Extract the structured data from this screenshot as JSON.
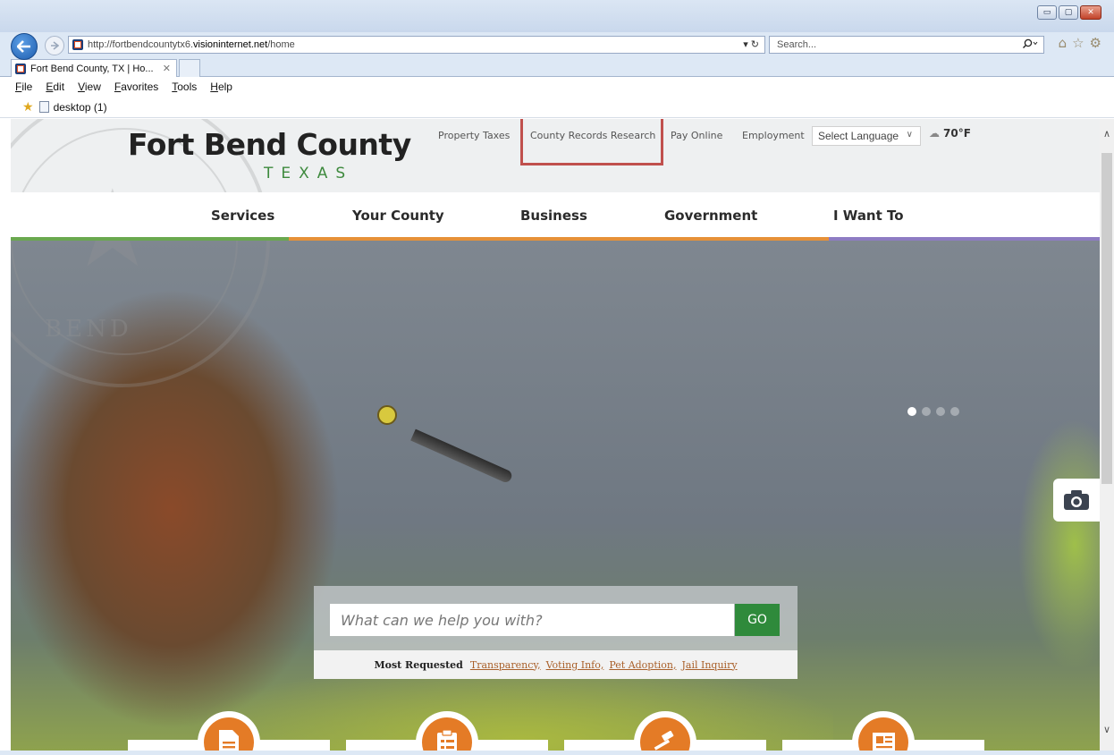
{
  "browser": {
    "url_prefix": "http://fortbendcountytx6.",
    "url_domain": "visioninternet.net",
    "url_suffix": "/home",
    "address_icons": "▾ ↻",
    "search_placeholder": "Search...",
    "tab_title": "Fort Bend County, TX | Ho...",
    "tab_close": "✕",
    "menu": [
      "File",
      "Edit",
      "View",
      "Favorites",
      "Tools",
      "Help"
    ],
    "favorites_item": "desktop (1)",
    "window_controls": [
      "▭",
      "▢",
      "✕"
    ],
    "toolbar_icons": [
      "home-icon",
      "star-icon",
      "gear-icon"
    ]
  },
  "site": {
    "title": "Fort Bend County",
    "subtitle": "TEXAS",
    "seal_text": "BEND",
    "utility_links": [
      "Property Taxes",
      "County Records Research",
      "Pay Online",
      "Employment"
    ],
    "language_select": "Select Language",
    "weather": "70°F",
    "main_nav": [
      "Services",
      "Your County",
      "Business",
      "Government",
      "I Want To"
    ],
    "search_placeholder": "What can we help you with?",
    "go_label": "GO",
    "most_requested_label": "Most Requested",
    "most_requested_links": [
      "Transparency,",
      "Voting Info,",
      "Pet Adoption,",
      "Jail Inquiry"
    ],
    "carousel": {
      "count": 4,
      "active": 1
    }
  },
  "colors": {
    "brand_green": "#3e8a3e",
    "go_button": "#2f8a3b",
    "link": "#a9602a",
    "nav_green": "#6aa84f",
    "nav_orange": "#e69138",
    "nav_purple": "#8e7cc3",
    "highlight": "#c0504d",
    "tile_icon": "#e47b26"
  }
}
